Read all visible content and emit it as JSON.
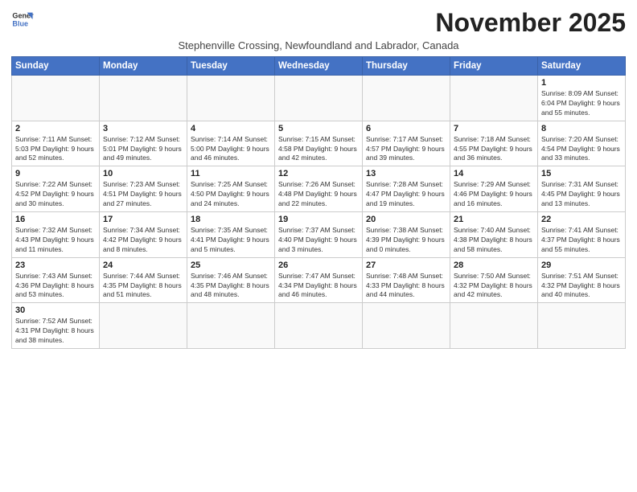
{
  "logo": {
    "line1": "General",
    "line2": "Blue"
  },
  "title": "November 2025",
  "subtitle": "Stephenville Crossing, Newfoundland and Labrador, Canada",
  "days_of_week": [
    "Sunday",
    "Monday",
    "Tuesday",
    "Wednesday",
    "Thursday",
    "Friday",
    "Saturday"
  ],
  "weeks": [
    [
      {
        "day": "",
        "info": ""
      },
      {
        "day": "",
        "info": ""
      },
      {
        "day": "",
        "info": ""
      },
      {
        "day": "",
        "info": ""
      },
      {
        "day": "",
        "info": ""
      },
      {
        "day": "",
        "info": ""
      },
      {
        "day": "1",
        "info": "Sunrise: 8:09 AM\nSunset: 6:04 PM\nDaylight: 9 hours and 55 minutes."
      }
    ],
    [
      {
        "day": "2",
        "info": "Sunrise: 7:11 AM\nSunset: 5:03 PM\nDaylight: 9 hours and 52 minutes."
      },
      {
        "day": "3",
        "info": "Sunrise: 7:12 AM\nSunset: 5:01 PM\nDaylight: 9 hours and 49 minutes."
      },
      {
        "day": "4",
        "info": "Sunrise: 7:14 AM\nSunset: 5:00 PM\nDaylight: 9 hours and 46 minutes."
      },
      {
        "day": "5",
        "info": "Sunrise: 7:15 AM\nSunset: 4:58 PM\nDaylight: 9 hours and 42 minutes."
      },
      {
        "day": "6",
        "info": "Sunrise: 7:17 AM\nSunset: 4:57 PM\nDaylight: 9 hours and 39 minutes."
      },
      {
        "day": "7",
        "info": "Sunrise: 7:18 AM\nSunset: 4:55 PM\nDaylight: 9 hours and 36 minutes."
      },
      {
        "day": "8",
        "info": "Sunrise: 7:20 AM\nSunset: 4:54 PM\nDaylight: 9 hours and 33 minutes."
      }
    ],
    [
      {
        "day": "9",
        "info": "Sunrise: 7:22 AM\nSunset: 4:52 PM\nDaylight: 9 hours and 30 minutes."
      },
      {
        "day": "10",
        "info": "Sunrise: 7:23 AM\nSunset: 4:51 PM\nDaylight: 9 hours and 27 minutes."
      },
      {
        "day": "11",
        "info": "Sunrise: 7:25 AM\nSunset: 4:50 PM\nDaylight: 9 hours and 24 minutes."
      },
      {
        "day": "12",
        "info": "Sunrise: 7:26 AM\nSunset: 4:48 PM\nDaylight: 9 hours and 22 minutes."
      },
      {
        "day": "13",
        "info": "Sunrise: 7:28 AM\nSunset: 4:47 PM\nDaylight: 9 hours and 19 minutes."
      },
      {
        "day": "14",
        "info": "Sunrise: 7:29 AM\nSunset: 4:46 PM\nDaylight: 9 hours and 16 minutes."
      },
      {
        "day": "15",
        "info": "Sunrise: 7:31 AM\nSunset: 4:45 PM\nDaylight: 9 hours and 13 minutes."
      }
    ],
    [
      {
        "day": "16",
        "info": "Sunrise: 7:32 AM\nSunset: 4:43 PM\nDaylight: 9 hours and 11 minutes."
      },
      {
        "day": "17",
        "info": "Sunrise: 7:34 AM\nSunset: 4:42 PM\nDaylight: 9 hours and 8 minutes."
      },
      {
        "day": "18",
        "info": "Sunrise: 7:35 AM\nSunset: 4:41 PM\nDaylight: 9 hours and 5 minutes."
      },
      {
        "day": "19",
        "info": "Sunrise: 7:37 AM\nSunset: 4:40 PM\nDaylight: 9 hours and 3 minutes."
      },
      {
        "day": "20",
        "info": "Sunrise: 7:38 AM\nSunset: 4:39 PM\nDaylight: 9 hours and 0 minutes."
      },
      {
        "day": "21",
        "info": "Sunrise: 7:40 AM\nSunset: 4:38 PM\nDaylight: 8 hours and 58 minutes."
      },
      {
        "day": "22",
        "info": "Sunrise: 7:41 AM\nSunset: 4:37 PM\nDaylight: 8 hours and 55 minutes."
      }
    ],
    [
      {
        "day": "23",
        "info": "Sunrise: 7:43 AM\nSunset: 4:36 PM\nDaylight: 8 hours and 53 minutes."
      },
      {
        "day": "24",
        "info": "Sunrise: 7:44 AM\nSunset: 4:35 PM\nDaylight: 8 hours and 51 minutes."
      },
      {
        "day": "25",
        "info": "Sunrise: 7:46 AM\nSunset: 4:35 PM\nDaylight: 8 hours and 48 minutes."
      },
      {
        "day": "26",
        "info": "Sunrise: 7:47 AM\nSunset: 4:34 PM\nDaylight: 8 hours and 46 minutes."
      },
      {
        "day": "27",
        "info": "Sunrise: 7:48 AM\nSunset: 4:33 PM\nDaylight: 8 hours and 44 minutes."
      },
      {
        "day": "28",
        "info": "Sunrise: 7:50 AM\nSunset: 4:32 PM\nDaylight: 8 hours and 42 minutes."
      },
      {
        "day": "29",
        "info": "Sunrise: 7:51 AM\nSunset: 4:32 PM\nDaylight: 8 hours and 40 minutes."
      }
    ],
    [
      {
        "day": "30",
        "info": "Sunrise: 7:52 AM\nSunset: 4:31 PM\nDaylight: 8 hours and 38 minutes."
      },
      {
        "day": "",
        "info": ""
      },
      {
        "day": "",
        "info": ""
      },
      {
        "day": "",
        "info": ""
      },
      {
        "day": "",
        "info": ""
      },
      {
        "day": "",
        "info": ""
      },
      {
        "day": "",
        "info": ""
      }
    ]
  ]
}
